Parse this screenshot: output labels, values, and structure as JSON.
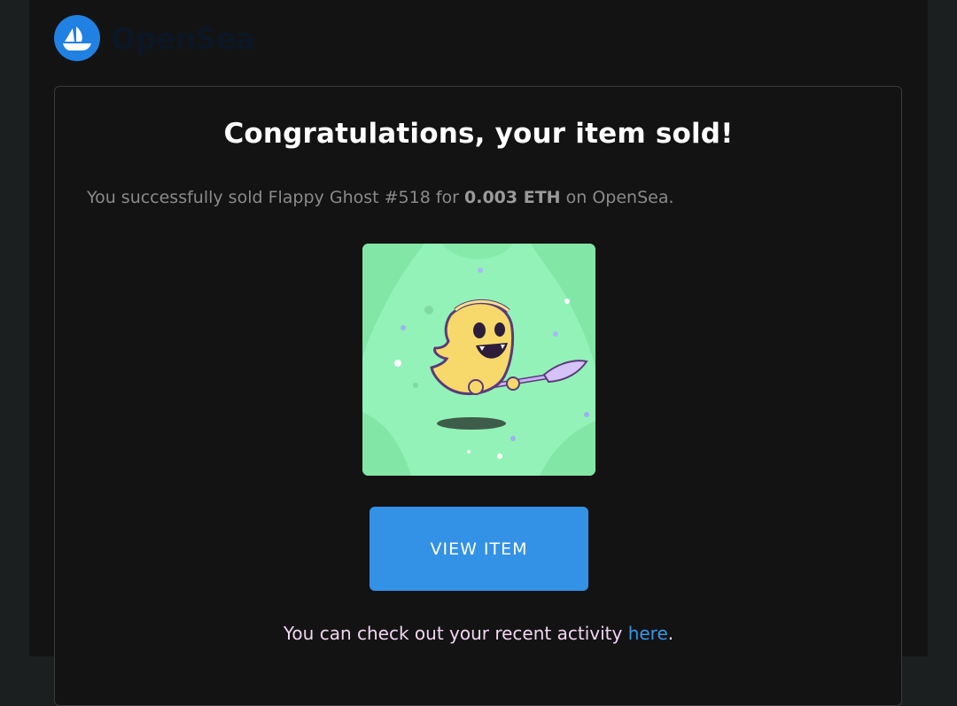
{
  "brand": {
    "name": "OpenSea",
    "logo_icon": "opensea-ship-icon",
    "logo_color": "#2081e2"
  },
  "email": {
    "headline": "Congratulations, your item sold!",
    "sold_prefix": "You successfully sold Flappy Ghost #518 for ",
    "sold_price": "0.003 ETH",
    "sold_suffix": " on OpenSea.",
    "view_button": "VIEW ITEM",
    "activity_prefix": "You can check out your recent activity ",
    "activity_link": "here",
    "activity_suffix": "."
  },
  "nft": {
    "name": "Flappy Ghost #518",
    "image_icon": "flappy-ghost-nft-image"
  },
  "colors": {
    "background": "#131313",
    "button": "#3391e6",
    "link": "#3a96e6",
    "nft_background": "#8ef0b3"
  }
}
